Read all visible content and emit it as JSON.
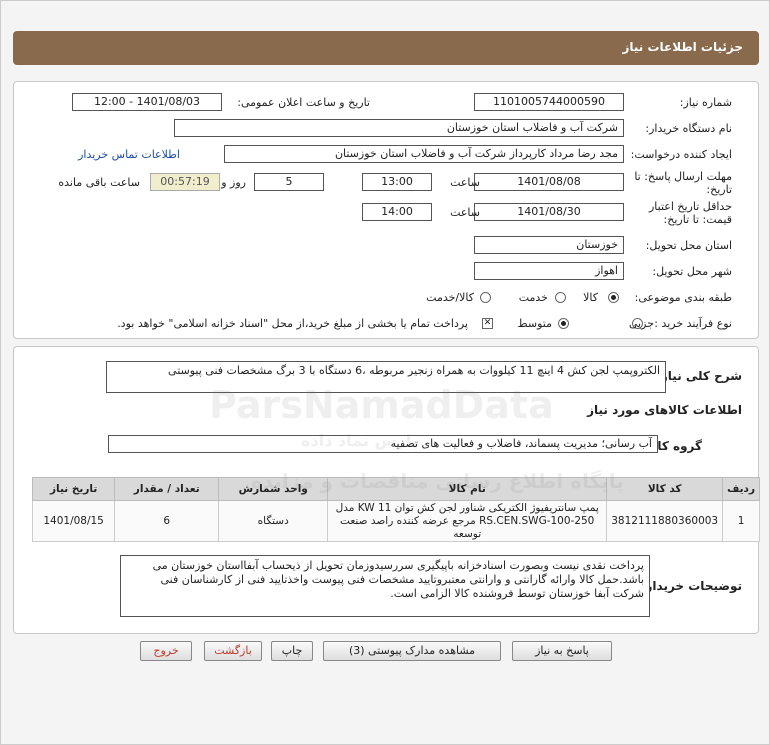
{
  "header": {
    "title": "جزئیات اطلاعات نیاز"
  },
  "form": {
    "need_number_label": "شماره نیاز:",
    "need_number": "1101005744000590",
    "announce_label": "تاریخ و ساعت اعلان عمومی:",
    "announce_value": "1401/08/03 - 12:00",
    "buyer_label": "نام دستگاه خریدار:",
    "buyer_value": "شرکت آب و فاضلاب استان خوزستان",
    "creator_label": "ایجاد کننده درخواست:",
    "creator_value": "مجد رضا مرداد کارپرداز شرکت آب و فاضلاب استان خوزستان",
    "contact_link": "اطلاعات تماس خریدار",
    "deadline_label": "مهلت ارسال پاسخ: تا تاریخ:",
    "deadline_date": "1401/08/08",
    "time_label": "ساعت",
    "deadline_time": "13:00",
    "days_value": "5",
    "days_label": "روز و",
    "timer_value": "00:57:19",
    "remaining_label": "ساعت باقی مانده",
    "validity_label": "حداقل تاریخ اعتبار قیمت: تا تاریخ:",
    "validity_date": "1401/08/30",
    "validity_time": "14:00",
    "province_label": "استان محل تحویل:",
    "province_value": "خوزستان",
    "city_label": "شهر محل تحویل:",
    "city_value": "اهواز",
    "category_label": "طبقه بندی موضوعی:",
    "category_options": [
      "کالا",
      "خدمت",
      "کالا/خدمت"
    ],
    "process_label": "نوع فرآیند خرید :",
    "process_options": [
      "جزیی",
      "متوسط"
    ],
    "payment_note": "پرداخت تمام یا بخشی از مبلغ خرید،از محل \"اسناد خزانه اسلامی\" خواهد بود."
  },
  "details": {
    "summary_label": "شرح کلی نیاز:",
    "summary_value": "الکتروپمپ لجن کش 4 اینچ 11 کیلووات به همراه زنجیر مربوطه ،6 دستگاه با 3 برگ مشخصات فنی پیوستی",
    "goods_info_title": "اطلاعات کالاهای مورد نیاز",
    "goods_group_label": "گروه کالا:",
    "goods_group_value": "آب رسانی؛ مدیریت پسماند، فاضلاب و فعالیت های تصفیه",
    "table": {
      "headers": [
        "ردیف",
        "کد کالا",
        "نام کالا",
        "واحد شمارش",
        "تعداد / مقدار",
        "تاریخ نیاز"
      ],
      "rows": [
        {
          "row": "1",
          "code": "3812111880360003",
          "name": "پمپ سانتریفیوژ الکتریکی شناور لجن کش توان KW 11 مدل RS.CEN.SWG-100-250 مرجع عرضه کننده راصد صنعت توسعه",
          "unit": "دستگاه",
          "qty": "6",
          "date": "1401/08/15"
        }
      ]
    },
    "buyer_notes_label": "توضیحات خریدار:",
    "buyer_notes_value": "پرداخت نقدی نیست وبصورت اسنادخزانه باپیگیری سررسیدوزمان تحویل از ذیحساب آبفااستان خوزستان می باشد.حمل کالا وارائه گارانتی و وارانتی معتبروتایید مشخصات فنی پیوست واخذتایید فنی از کارشناسان فنی شرکت آبفا خوزستان توسط فروشنده کالا الزامی است."
  },
  "buttons": {
    "reply": "پاسخ به نیاز",
    "attachments": "مشاهده مدارک پیوستی (3)",
    "print": "چاپ",
    "back": "بازگشت",
    "exit": "خروج"
  },
  "watermark": {
    "brand": "ParsNamadData",
    "line1": "پایگاه اطلاع رسانی مناقصات و مزایده",
    "line2": "پارس نماد داده"
  }
}
